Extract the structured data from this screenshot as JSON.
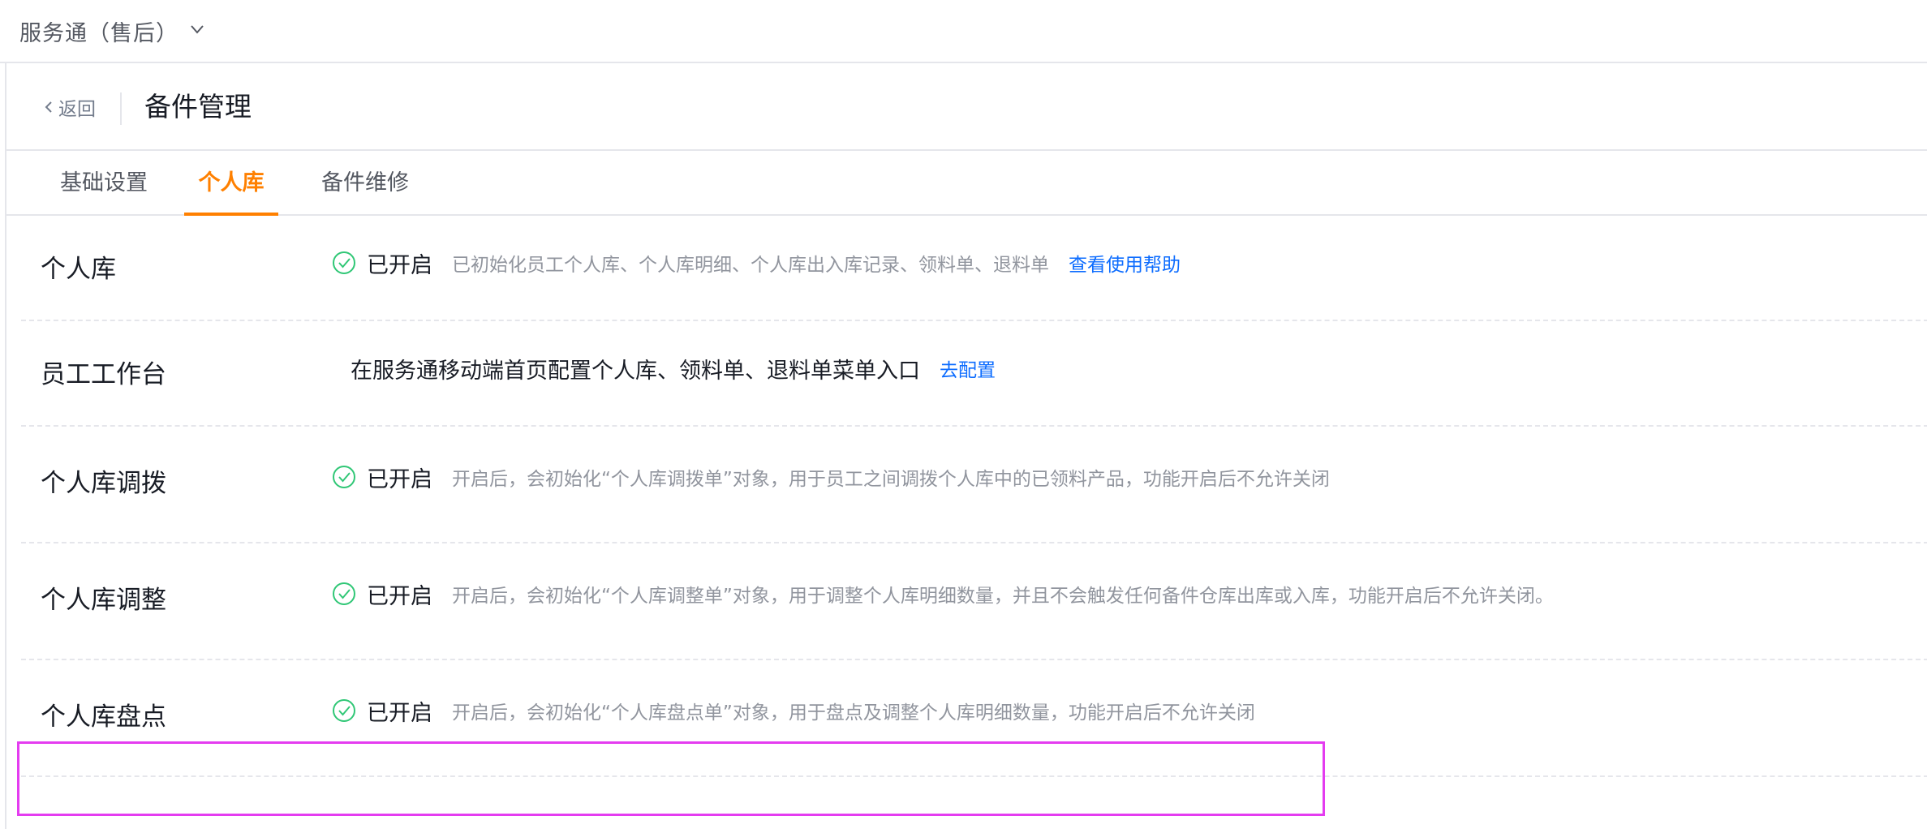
{
  "topbar": {
    "app_title": "服务通（售后）",
    "dropdown_icon": "chevron-down-icon"
  },
  "header": {
    "back_label": "返回",
    "page_title": "备件管理"
  },
  "tabs": [
    {
      "label": "基础设置",
      "active": false
    },
    {
      "label": "个人库",
      "active": true
    },
    {
      "label": "备件维修",
      "active": false
    }
  ],
  "rows": [
    {
      "label": "个人库",
      "status": "已开启",
      "description": "已初始化员工个人库、个人库明细、个人库出入库记录、领料单、退料单",
      "link": "查看使用帮助"
    },
    {
      "label": "员工工作台",
      "description": "在服务通移动端首页配置个人库、领料单、退料单菜单入口",
      "link": "去配置"
    },
    {
      "label": "个人库调拨",
      "status": "已开启",
      "description": "开启后，会初始化“个人库调拨单”对象，用于员工之间调拨个人库中的已领料产品，功能开启后不允许关闭"
    },
    {
      "label": "个人库调整",
      "status": "已开启",
      "description": "开启后，会初始化“个人库调整单”对象，用于调整个人库明细数量，并且不会触发任何备件仓库出库或入库，功能开启后不允许关闭。"
    },
    {
      "label": "个人库盘点",
      "status": "已开启",
      "description": "开启后，会初始化“个人库盘点单”对象，用于盘点及调整个人库明细数量，功能开启后不允许关闭"
    }
  ],
  "colors": {
    "accent": "#ff8000",
    "link": "#0c6cff",
    "success": "#30c776",
    "highlight": "#e43cf0"
  }
}
